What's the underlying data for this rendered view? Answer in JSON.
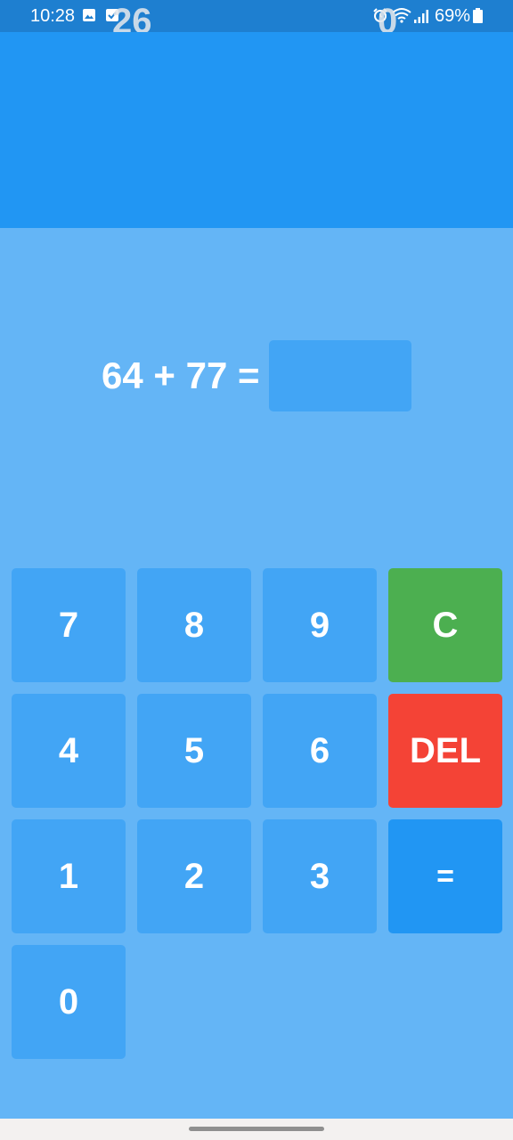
{
  "status_bar": {
    "time": "10:28",
    "battery": "69%",
    "icons": [
      "gallery-icon",
      "check-icon",
      "alarm-icon",
      "wifi-icon",
      "signal-icon",
      "battery-icon"
    ]
  },
  "scores": {
    "left": "26",
    "right": "0"
  },
  "equation": {
    "text": "64 + 77 =",
    "answer": ""
  },
  "keypad": {
    "key_7": "7",
    "key_8": "8",
    "key_9": "9",
    "key_clear": "C",
    "key_4": "4",
    "key_5": "5",
    "key_6": "6",
    "key_del": "DEL",
    "key_1": "1",
    "key_2": "2",
    "key_3": "3",
    "key_equals": "=",
    "key_0": "0"
  },
  "colors": {
    "background": "#64b5f6",
    "header": "#2196f3",
    "status_bar": "#1e7fd0",
    "key": "#42a5f5",
    "clear": "#4caf50",
    "delete": "#f44336",
    "equals": "#2196f3"
  }
}
